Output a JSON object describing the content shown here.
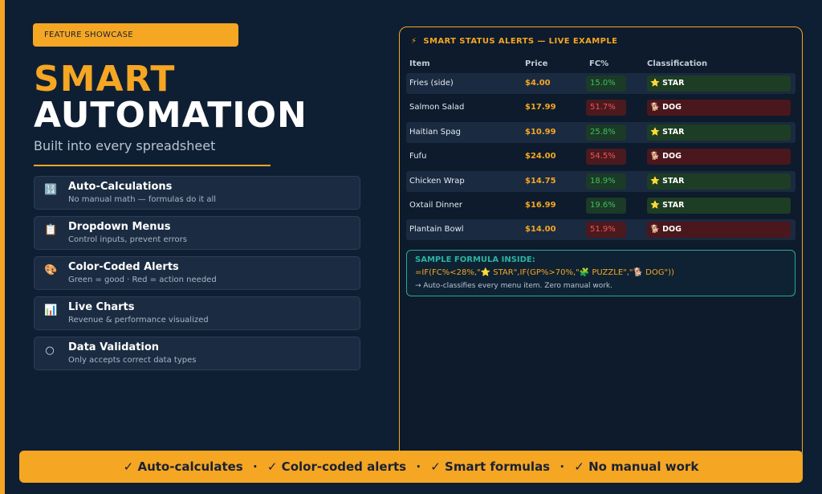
{
  "badge": "FEATURE SHOWCASE",
  "title_line1": "SMART",
  "title_line2": "AUTOMATION",
  "subtitle": "Built into every spreadsheet",
  "features": [
    {
      "icon": "🔢",
      "icon_name": "calculator-icon",
      "title": "Auto-Calculations",
      "desc": "No manual math — formulas do it all"
    },
    {
      "icon": "📋",
      "icon_name": "dropdown-icon",
      "title": "Dropdown Menus",
      "desc": "Control inputs, prevent errors"
    },
    {
      "icon": "🎨",
      "icon_name": "palette-icon",
      "title": "Color-Coded Alerts",
      "desc": "Green = good · Red = action needed"
    },
    {
      "icon": "📊",
      "icon_name": "chart-icon",
      "title": "Live Charts",
      "desc": "Revenue & performance visualized"
    },
    {
      "icon": "○",
      "icon_name": "circle-icon",
      "title": "Data Validation",
      "desc": "Only accepts correct data types"
    }
  ],
  "panel": {
    "icon": "⚡",
    "title": "SMART STATUS ALERTS — LIVE EXAMPLE",
    "columns": [
      "Item",
      "Price",
      "FC%",
      "Classification"
    ],
    "rows": [
      {
        "item": "Fries (side)",
        "price": "$4.00",
        "fc": "15.0%",
        "status": "good",
        "cls_icon": "⭐",
        "cls": "STAR"
      },
      {
        "item": "Salmon Salad",
        "price": "$17.99",
        "fc": "51.7%",
        "status": "bad",
        "cls_icon": "🐕",
        "cls": "DOG"
      },
      {
        "item": "Haitian Spag",
        "price": "$10.99",
        "fc": "25.8%",
        "status": "good",
        "cls_icon": "⭐",
        "cls": "STAR"
      },
      {
        "item": "Fufu",
        "price": "$24.00",
        "fc": "54.5%",
        "status": "bad",
        "cls_icon": "🐕",
        "cls": "DOG"
      },
      {
        "item": "Chicken Wrap",
        "price": "$14.75",
        "fc": "18.9%",
        "status": "good",
        "cls_icon": "⭐",
        "cls": "STAR"
      },
      {
        "item": "Oxtail Dinner",
        "price": "$16.99",
        "fc": "19.6%",
        "status": "good",
        "cls_icon": "⭐",
        "cls": "STAR"
      },
      {
        "item": "Plantain Bowl",
        "price": "$14.00",
        "fc": "51.9%",
        "status": "bad",
        "cls_icon": "🐕",
        "cls": "DOG"
      }
    ],
    "formula_label": "SAMPLE FORMULA INSIDE:",
    "formula_code": "=IF(FC%<28%,\"⭐ STAR\",IF(GP%>70%,\"🧩 PUZZLE\",\"🐕 DOG\"))",
    "formula_note": "→ Auto-classifies every menu item. Zero manual work."
  },
  "footer": [
    "✓ Auto-calculates",
    "✓ Color-coded alerts",
    "✓ Smart formulas",
    "✓ No manual work"
  ],
  "footer_sep": "·",
  "colors": {
    "accent": "#f5a623",
    "background": "#0f1f33",
    "good": "#3fbf5b",
    "bad": "#f05555",
    "teal": "#2bb3a3"
  }
}
